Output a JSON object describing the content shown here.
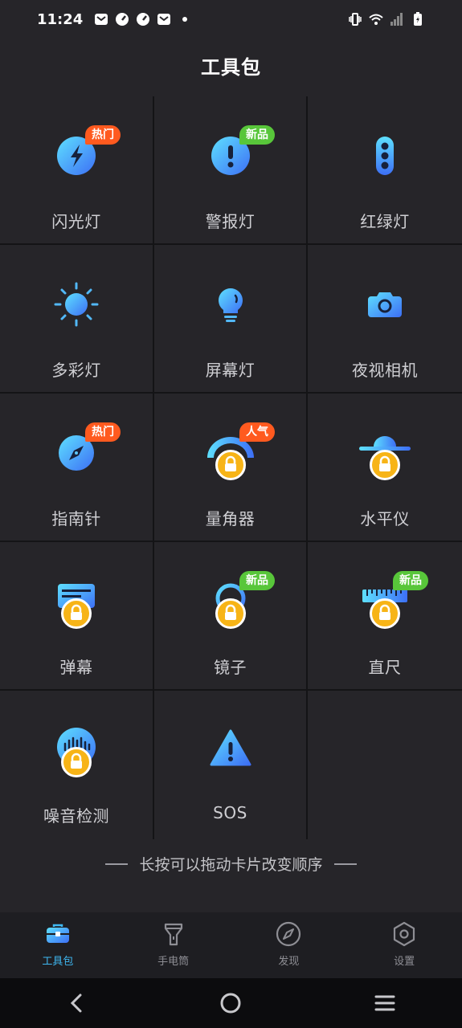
{
  "status": {
    "time": "11:24"
  },
  "page_title": "工具包",
  "tools": [
    {
      "label": "闪光灯",
      "icon": "flash-icon",
      "badge": "热门",
      "badge_type": "hot",
      "locked": false
    },
    {
      "label": "警报灯",
      "icon": "alarm-icon",
      "badge": "新品",
      "badge_type": "new",
      "locked": false
    },
    {
      "label": "红绿灯",
      "icon": "traffic-light-icon",
      "badge": "",
      "badge_type": "",
      "locked": false
    },
    {
      "label": "多彩灯",
      "icon": "sun-icon",
      "badge": "",
      "badge_type": "",
      "locked": false
    },
    {
      "label": "屏幕灯",
      "icon": "bulb-icon",
      "badge": "",
      "badge_type": "",
      "locked": false
    },
    {
      "label": "夜视相机",
      "icon": "camera-icon",
      "badge": "",
      "badge_type": "",
      "locked": false
    },
    {
      "label": "指南针",
      "icon": "compass-icon",
      "badge": "热门",
      "badge_type": "hot",
      "locked": false
    },
    {
      "label": "量角器",
      "icon": "protractor-icon",
      "badge": "人气",
      "badge_type": "pop",
      "locked": true
    },
    {
      "label": "水平仪",
      "icon": "level-icon",
      "badge": "",
      "badge_type": "",
      "locked": true
    },
    {
      "label": "弹幕",
      "icon": "barrage-icon",
      "badge": "",
      "badge_type": "",
      "locked": true
    },
    {
      "label": "镜子",
      "icon": "mirror-icon",
      "badge": "新品",
      "badge_type": "new",
      "locked": true
    },
    {
      "label": "直尺",
      "icon": "ruler-icon",
      "badge": "新品",
      "badge_type": "new",
      "locked": true
    },
    {
      "label": "噪音检测",
      "icon": "noise-meter-icon",
      "badge": "",
      "badge_type": "",
      "locked": true
    },
    {
      "label": "SOS",
      "icon": "warning-icon",
      "badge": "",
      "badge_type": "",
      "locked": false
    }
  ],
  "hint": "长按可以拖动卡片改变顺序",
  "tabs": [
    {
      "label": "工具包",
      "icon": "toolbox-icon",
      "active": true
    },
    {
      "label": "手电筒",
      "icon": "flashlight-icon",
      "active": false
    },
    {
      "label": "发现",
      "icon": "discover-compass-icon",
      "active": false
    },
    {
      "label": "设置",
      "icon": "settings-icon",
      "active": false
    }
  ],
  "colors": {
    "background": "#262529",
    "accent": "#3fb8f2",
    "badge_hot": "#ff5a1f",
    "badge_new": "#58c63a",
    "lock": "#f7b417"
  }
}
